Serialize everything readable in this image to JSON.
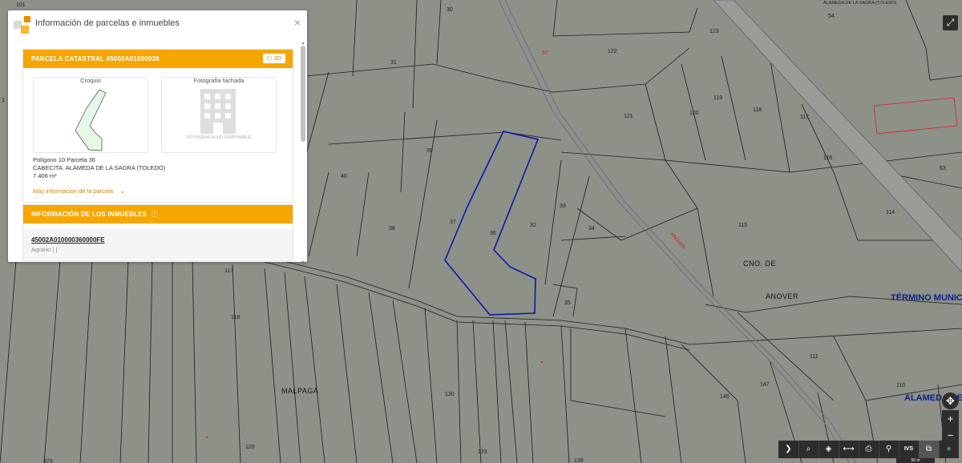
{
  "panel": {
    "title": "Información de parcelas e inmuebles",
    "close_glyph": "×",
    "parcel_header": "PARCELA CATASTRAL 45002A01000036",
    "btn_3d": "3D",
    "croquis_label": "Croquis",
    "foto_label": "Fotografía fachada",
    "foto_unavailable": "FOTOGRAFÍA NO DISPONIBLE",
    "poligono": "Polígono 10 Parcela 36",
    "location": "CABECITA. ALAMEDA DE LA SAGRA (TOLEDO)",
    "area": "7.406 m²",
    "more_info": "Más información de la parcela",
    "inmuebles_header": "INFORMACIÓN DE LOS INMUEBLES",
    "ref_catastral": "45002A010000360000FE",
    "uso": "Agrario",
    "uso_sep": "| |"
  },
  "map": {
    "top_coords": "ALAMEDA DE LA SAGRA (TOLEDO)",
    "parcel_labels": [
      "101",
      "30",
      "54",
      "123",
      "31",
      "122",
      "57",
      "121",
      "120",
      "119",
      "118",
      "117",
      "116",
      "63",
      "114",
      "115",
      "39",
      "37",
      "38",
      "36",
      "40",
      "32",
      "33",
      "34",
      "35",
      "117",
      "118",
      "130",
      "133",
      "139",
      "120",
      "373",
      "146",
      "147",
      "111",
      "110",
      "1"
    ],
    "places": {
      "malpaga": "MALPAGA",
      "cno_de": "CNO. DE",
      "anover": "ANOVER",
      "termino": "TÉRMINO MUNIC",
      "alameda": "ALAMEDA DE"
    },
    "road_label": "ANOVER",
    "selected_parcel_color": "#0a1aa8",
    "highlight_parcel_color": "#d03030"
  },
  "toolbar": {
    "items": [
      "chevron-right-icon",
      "search-icon",
      "layers-icon",
      "measure-icon",
      "print-icon",
      "route-icon",
      "ivs-label",
      "cadastre-icon",
      "globe-icon"
    ],
    "ivs": "IVS",
    "scale": "50 m"
  },
  "colors": {
    "map_bg": "#8e9188",
    "header": "#f5a600",
    "link": "#e07b00"
  }
}
